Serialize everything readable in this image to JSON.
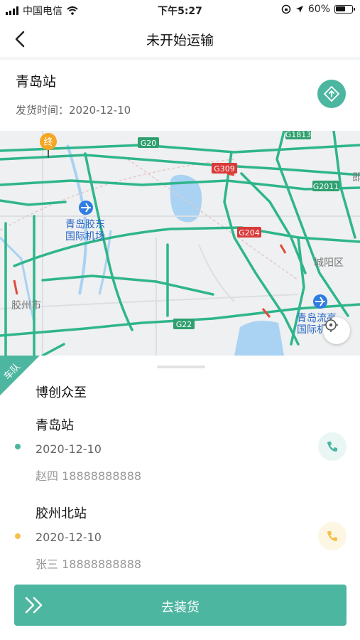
{
  "status_bar": {
    "carrier": "中国电信",
    "time": "下午5:27",
    "battery": "60%",
    "battery_level": 0.6
  },
  "header": {
    "title": "未开始运输",
    "back_icon": "chevron-left-icon"
  },
  "origin_card": {
    "station": "青岛站",
    "ship_time_label": "发货时间：",
    "ship_time": "2020-12-10",
    "nav_icon": "navigation-arrow-icon"
  },
  "map": {
    "end_marker": "终",
    "labels": {
      "airport": "青岛胶东\n国际机场",
      "airport_line1": "青岛胶东",
      "airport_line2": "国际机场",
      "jiaozhou": "胶州市",
      "chengyang": "城阳区",
      "liuting1": "青岛流亭",
      "liuting2": "国际机",
      "edge": "即"
    },
    "road_shields": [
      "G20",
      "G309",
      "G204",
      "G22",
      "G2011",
      "G1813"
    ]
  },
  "fleet": {
    "tag": "车队",
    "company": "博创众至"
  },
  "stops": [
    {
      "name": "青岛站",
      "date": "2020-12-10",
      "contact": "赵四 18888888888",
      "color": "#4db6a0",
      "phone_bg": "#e9f6f3"
    },
    {
      "name": "胶州北站",
      "date": "2020-12-10",
      "contact": "张三 18888888888",
      "color": "#f5c04a",
      "phone_bg": "#fdf6e3"
    }
  ],
  "action": {
    "label": "去装货"
  },
  "colors": {
    "accent": "#4db6a0",
    "warning": "#f5c04a"
  }
}
